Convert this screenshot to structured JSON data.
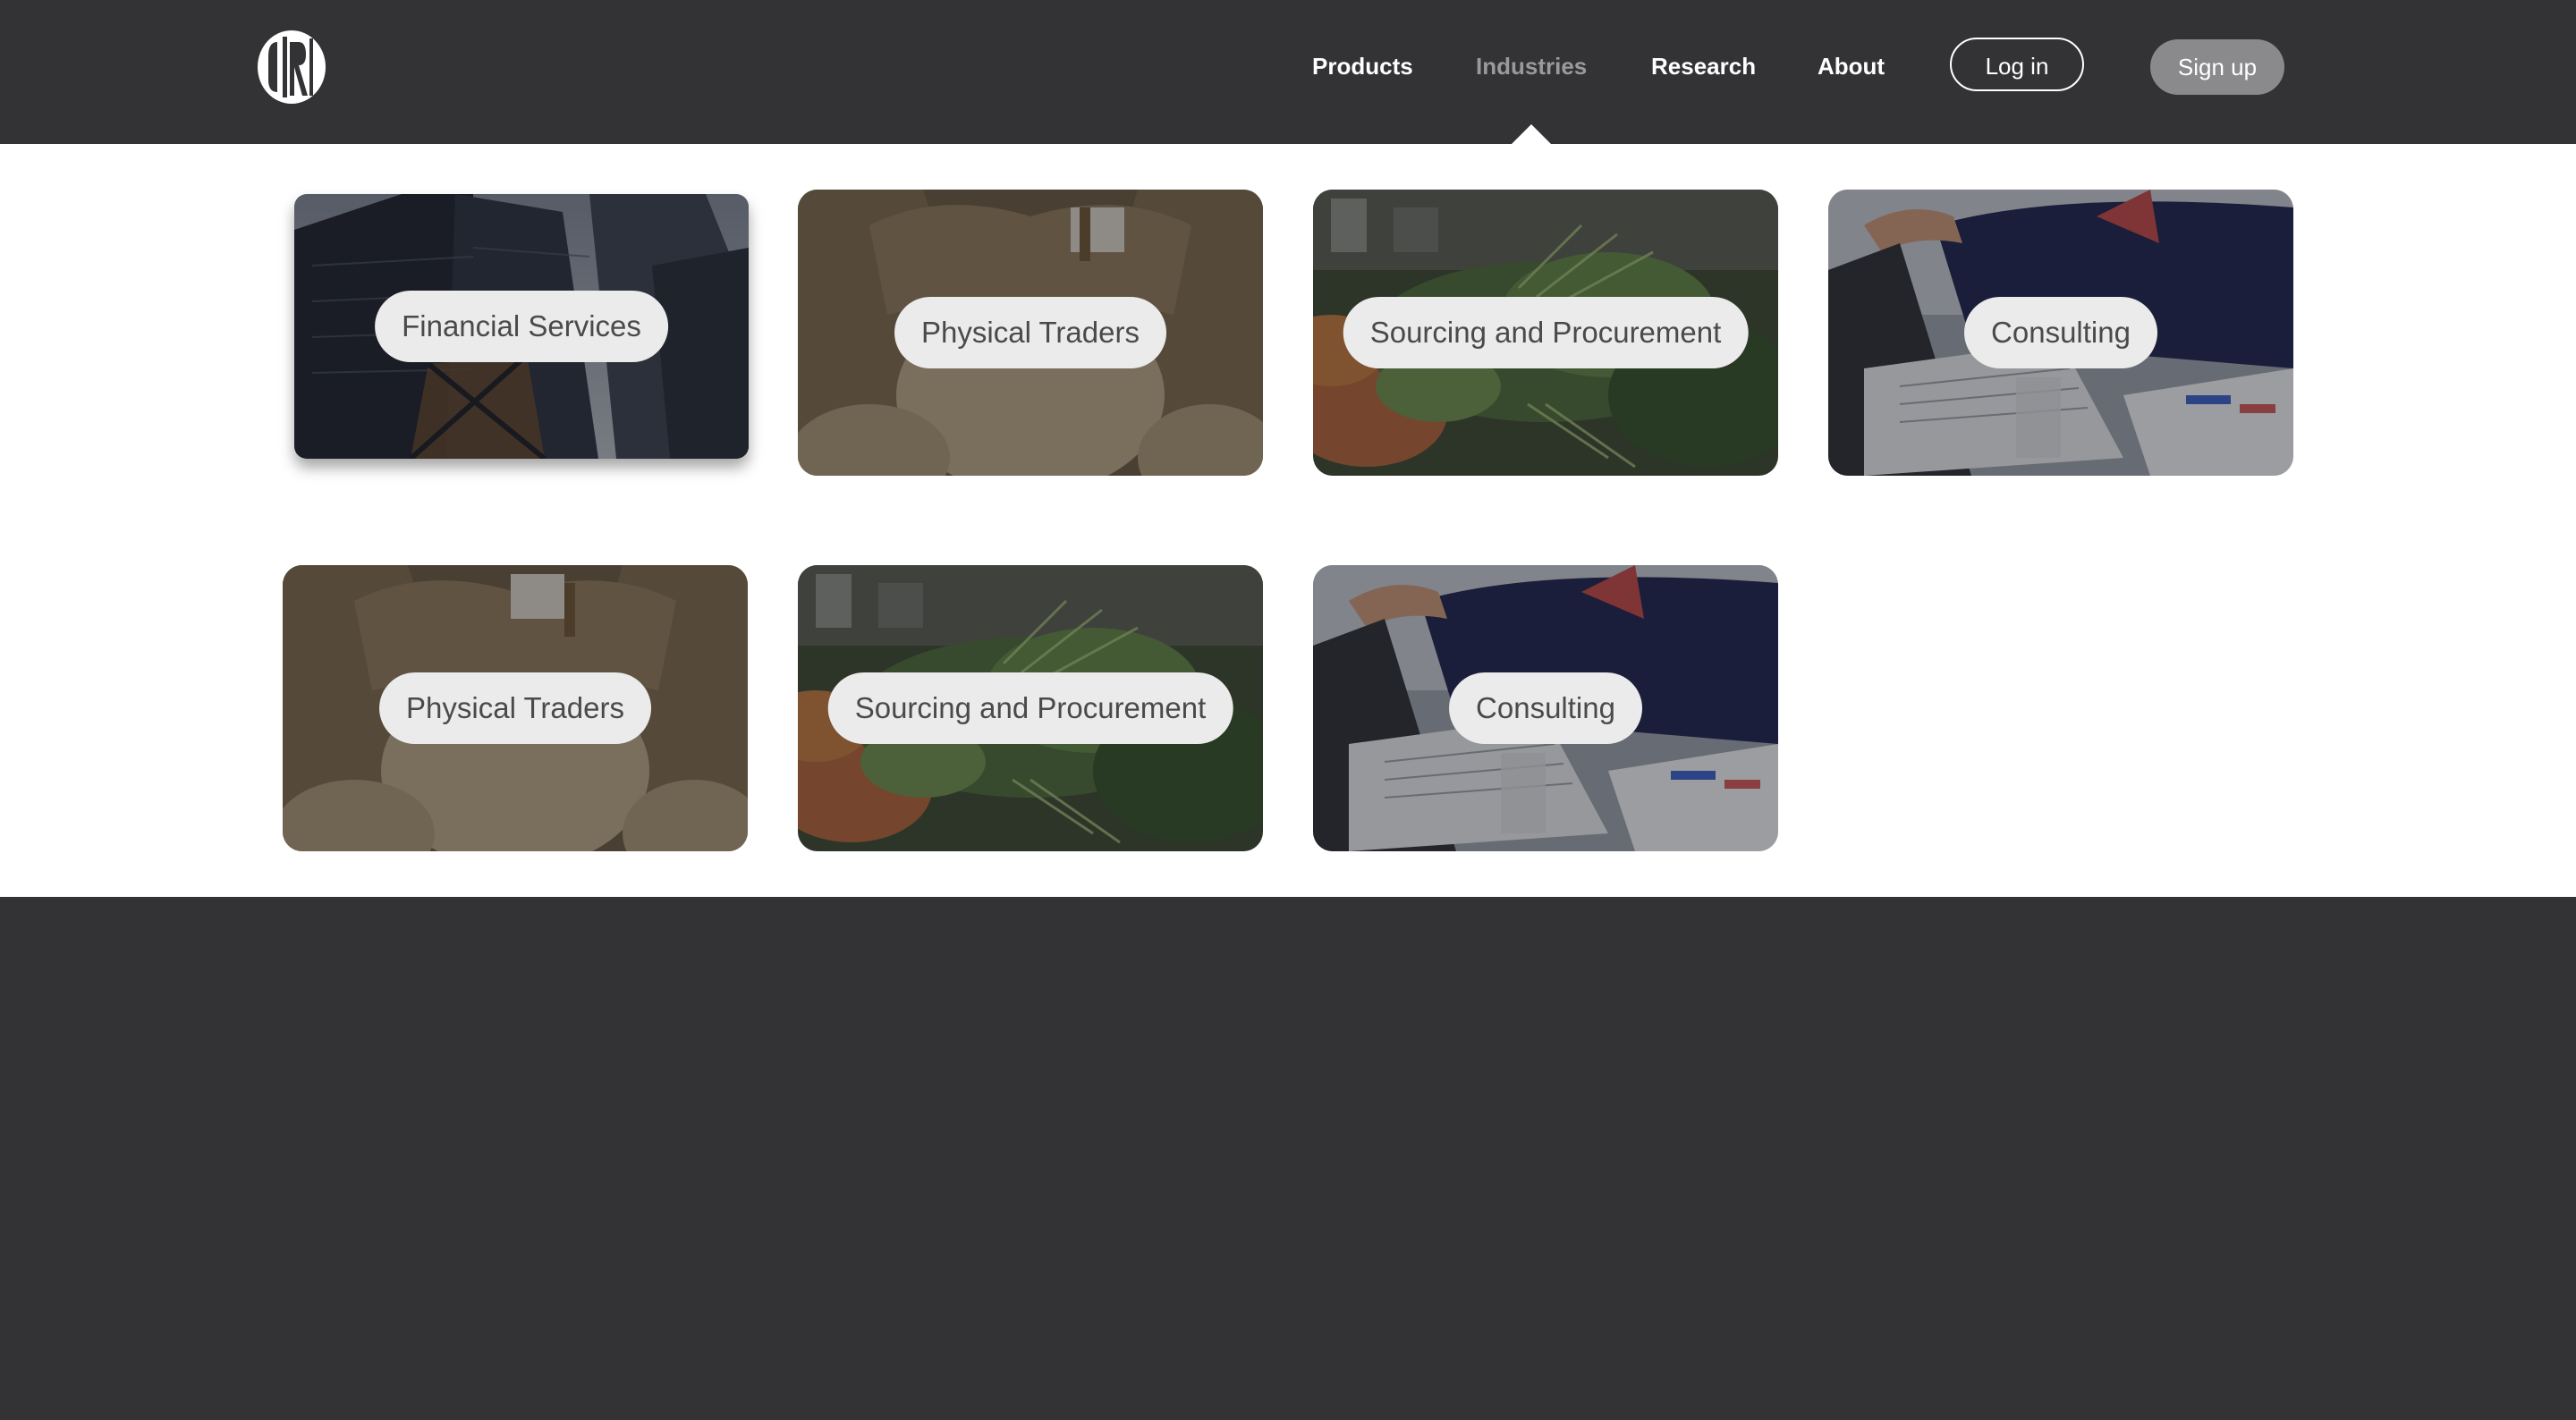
{
  "nav": {
    "logo_text": "GRO",
    "products": "Products",
    "industries": "Industries",
    "research": "Research",
    "about": "About",
    "login": "Log in",
    "signup": "Sign up"
  },
  "industries": {
    "row1": [
      {
        "label": "Financial Services",
        "image": "city-skyscrapers"
      },
      {
        "label": "Physical Traders",
        "image": "grain-sacks"
      },
      {
        "label": "Sourcing and Procurement",
        "image": "vegetable-market"
      },
      {
        "label": "Consulting",
        "image": "business-meeting"
      }
    ],
    "row2": [
      {
        "label": "Physical Traders",
        "image": "grain-sacks"
      },
      {
        "label": "Sourcing and Procurement",
        "image": "vegetable-market"
      },
      {
        "label": "Consulting",
        "image": "business-meeting"
      }
    ]
  },
  "colors": {
    "header_bg": "#333335",
    "panel_bg": "#ffffff",
    "nav_text": "#ffffff",
    "nav_active": "#9a9a9c",
    "signup_bg": "#8a8a8c",
    "pill_bg": "#ebebeb",
    "pill_text": "#4a4a4c"
  }
}
